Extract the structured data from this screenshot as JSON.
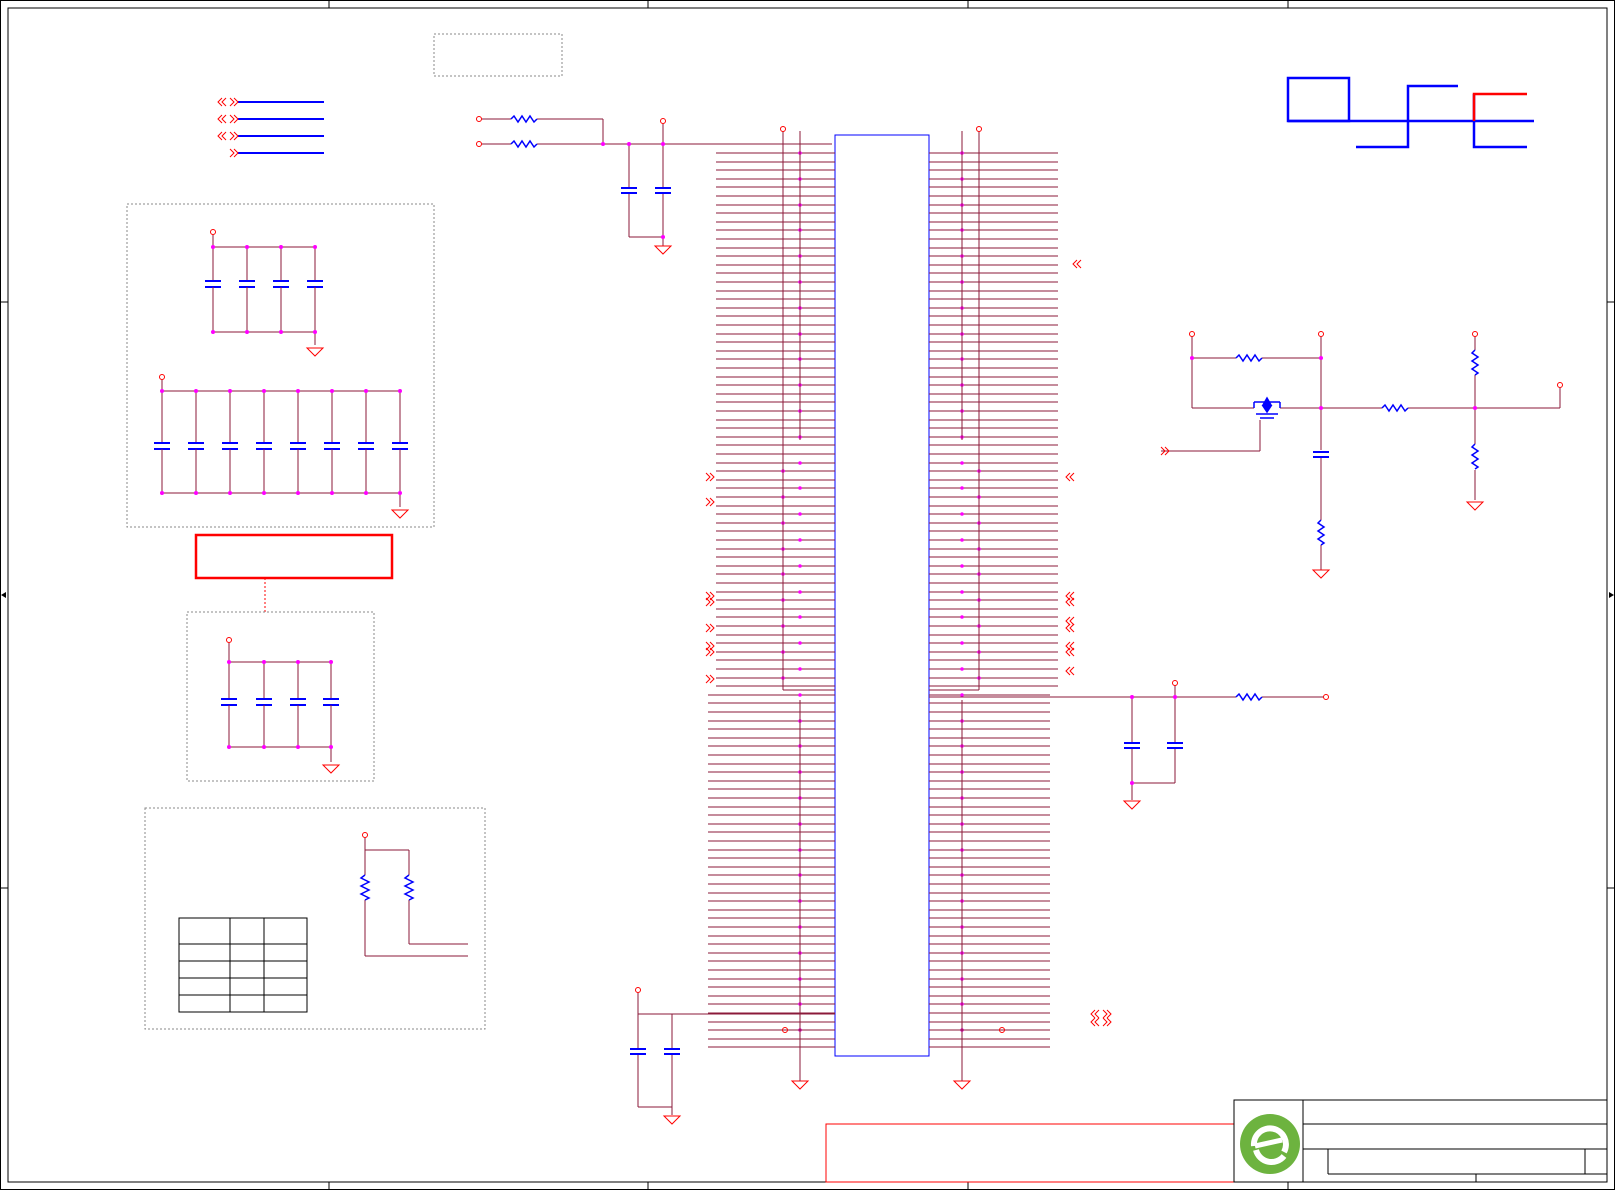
{
  "title": "",
  "colors": {
    "frame": "#000000",
    "wire": "#8b1a3a",
    "component": "#0000ff",
    "junction": "#ff00ff",
    "power": "#e00000",
    "ground": "#ff0000",
    "dashed_box": "#808080",
    "note_box": "#ff0000",
    "logo": "#6db33f"
  },
  "icons": {
    "logo": "company-logo-icon",
    "offpage_connector": "double-chevron-icon",
    "ground": "ground-symbol-icon"
  }
}
